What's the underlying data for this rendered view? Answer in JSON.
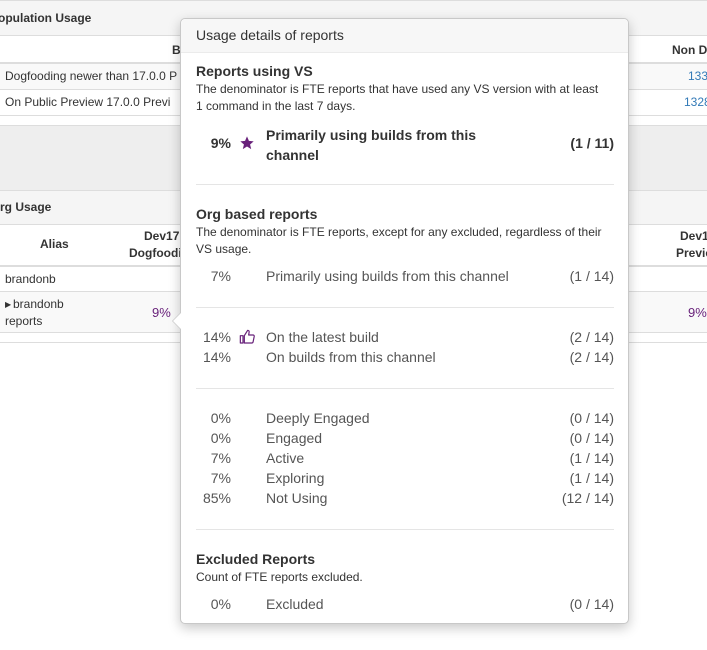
{
  "population_panel": {
    "title": "opulation Usage",
    "col_b": "B",
    "col_non": "Non D",
    "rows": [
      {
        "label": "Dogfooding newer than 17.0.0 P",
        "value": "133"
      },
      {
        "label": "On Public Preview 17.0.0 Previ",
        "value": "1328"
      }
    ]
  },
  "org_panel": {
    "title": "rg Usage",
    "col_alias": "Alias",
    "col_dev17_line1": "Dev17",
    "col_dev17_line2": "Dogfoodin",
    "col_dev17b_line1": "Dev1",
    "col_dev17b_line2": "Previe",
    "rows": [
      {
        "alias": "brandonb"
      },
      {
        "alias_line1": "brandonb",
        "alias_line2": "reports",
        "value": "9%",
        "value_right": "9%"
      }
    ]
  },
  "popover": {
    "title": "Usage details of reports",
    "sections": {
      "vs": {
        "heading": "Reports using VS",
        "desc": "The denominator is FTE reports that have used any VS version with at least 1 command in the last 7 days.",
        "stat": {
          "pct": "9%",
          "icon": "star-icon",
          "label_line1": "Primarily using builds from this",
          "label_line2": "channel",
          "count": "(1 / 11)"
        }
      },
      "org": {
        "heading": "Org based reports",
        "desc": "The denominator is FTE reports, except for any excluded, regardless of their VS usage.",
        "stat": {
          "pct": "7%",
          "label": "Primarily using builds from this channel",
          "count": "(1 / 14)"
        }
      },
      "build": [
        {
          "pct": "14%",
          "icon": "thumbs-up-icon",
          "label": "On the latest build",
          "count": "(2 / 14)"
        },
        {
          "pct": "14%",
          "label": "On builds from this channel",
          "count": "(2 / 14)"
        }
      ],
      "engagement": [
        {
          "pct": "0%",
          "label": "Deeply Engaged",
          "count": "(0 / 14)"
        },
        {
          "pct": "0%",
          "label": "Engaged",
          "count": "(0 / 14)"
        },
        {
          "pct": "7%",
          "label": "Active",
          "count": "(1 / 14)"
        },
        {
          "pct": "7%",
          "label": "Exploring",
          "count": "(1 / 14)"
        },
        {
          "pct": "85%",
          "label": "Not Using",
          "count": "(12 / 14)"
        }
      ],
      "excluded": {
        "heading": "Excluded Reports",
        "desc": "Count of FTE reports excluded.",
        "stat": {
          "pct": "0%",
          "label": "Excluded",
          "count": "(0 / 14)"
        }
      }
    },
    "accent_color": "#68217a",
    "link_color": "#337ab7"
  }
}
